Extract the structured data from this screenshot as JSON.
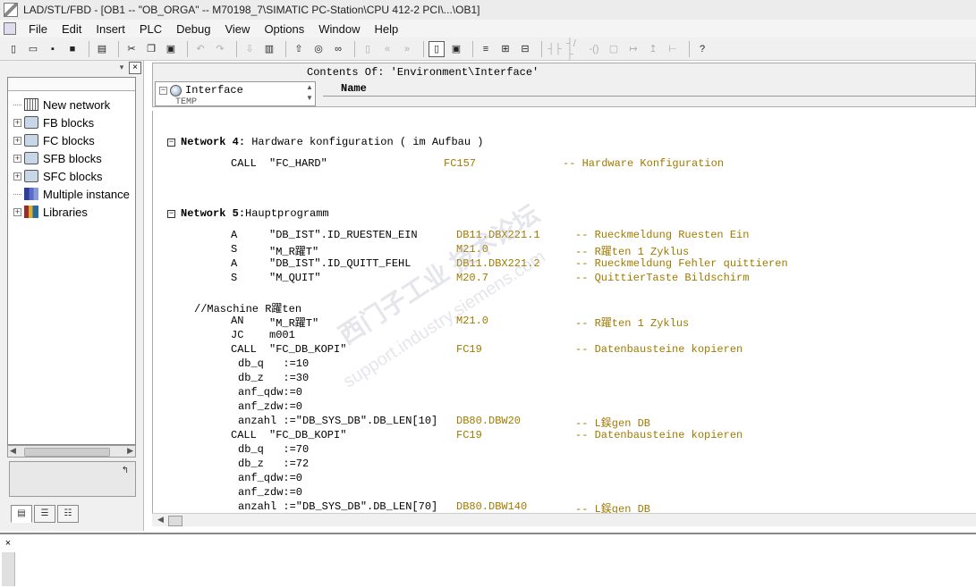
{
  "window": {
    "title": "LAD/STL/FBD  - [OB1 -- \"OB_ORGA\" -- M70198_7\\SIMATIC PC-Station\\CPU 412-2 PCI\\...\\OB1]"
  },
  "menu": {
    "items": [
      "File",
      "Edit",
      "Insert",
      "PLC",
      "Debug",
      "View",
      "Options",
      "Window",
      "Help"
    ]
  },
  "toolbar": {
    "icons": [
      "new-icon",
      "open-icon",
      "accessible-nodes-icon",
      "save-icon",
      "print-icon",
      "cut-icon",
      "copy-icon",
      "paste-icon",
      "undo-icon",
      "redo-icon",
      "load-icon",
      "module-info-icon",
      "load-icon-2",
      "monitor-icon",
      "insert-network-icon",
      "prev-network-icon",
      "next-network-icon",
      "overview-icon",
      "detail-icon",
      "ladder-icon",
      "branch-icon",
      "function-icon",
      "contact-no-icon",
      "contact-nc-icon",
      "coil-icon",
      "box-icon",
      "open-branch-icon",
      "close-branch-icon",
      "help-icon"
    ]
  },
  "sidebar": {
    "tree": [
      {
        "label": "New network",
        "icon": "network-icon",
        "expandable": false
      },
      {
        "label": "FB blocks",
        "icon": "fb-block-icon",
        "expandable": true
      },
      {
        "label": "FC blocks",
        "icon": "fc-block-icon",
        "expandable": true
      },
      {
        "label": "SFB blocks",
        "icon": "sfb-block-icon",
        "expandable": true
      },
      {
        "label": "SFC blocks",
        "icon": "sfc-block-icon",
        "expandable": true
      },
      {
        "label": "Multiple instance",
        "icon": "multiple-instance-icon",
        "expandable": false
      },
      {
        "label": "Libraries",
        "icon": "libraries-icon",
        "expandable": true
      }
    ],
    "expand_symbol": "+"
  },
  "interface": {
    "contents_of": "Contents Of: 'Environment\\Interface'",
    "root_label": "Interface",
    "sub_label": "TEMP",
    "name_header": "Name"
  },
  "networks": [
    {
      "number": "Network 4",
      "colon": ":",
      "title": " Hardware konfiguration ( im Aufbau )"
    },
    {
      "number": "Network 5",
      "colon": ":",
      "title": "Hauptprogramm"
    }
  ],
  "code": {
    "n4": [
      {
        "op": "CALL",
        "operand": "\"FC_HARD\"",
        "addr": "FC157",
        "comment": "-- Hardware Konfiguration"
      }
    ],
    "n5a": [
      {
        "op": "A",
        "operand": "\"DB_IST\".ID_RUESTEN_EIN",
        "addr": "DB11.DBX221.1",
        "comment": "-- Rueckmeldung Ruesten Ein"
      },
      {
        "op": "S",
        "operand": "\"M_R躍T\"",
        "addr": "M21.0",
        "comment": "-- R躍ten 1 Zyklus"
      },
      {
        "op": "A",
        "operand": "\"DB_IST\".ID_QUITT_FEHL",
        "addr": "DB11.DBX221.2",
        "comment": "-- Rueckmeldung Fehler quittieren"
      },
      {
        "op": "S",
        "operand": "\"M_QUIT\"",
        "addr": "M20.7",
        "comment": "-- QuittierTaste Bildschirm"
      }
    ],
    "label_comment": "//Maschine R躍ten",
    "n5b": [
      {
        "op": "AN",
        "operand": "\"M_R躍T\"",
        "addr": "M21.0",
        "comment": "-- R躍ten 1 Zyklus"
      },
      {
        "op": "JC",
        "operand": "m001",
        "addr": "",
        "comment": ""
      },
      {
        "op": "CALL",
        "operand": "\"FC_DB_KOPI\"",
        "addr": "FC19",
        "comment": "-- Datenbausteine kopieren"
      }
    ],
    "params1": [
      "db_q   :=10",
      "db_z   :=30",
      "anf_qdw:=0",
      "anf_zdw:=0"
    ],
    "anzahl1": {
      "text": "anzahl :=\"DB_SYS_DB\".DB_LEN[10]",
      "addr": "DB80.DBW20",
      "comment": "-- L鋘gen DB"
    },
    "call2": {
      "op": "CALL",
      "operand": "\"FC_DB_KOPI\"",
      "addr": "FC19",
      "comment": "-- Datenbausteine kopieren"
    },
    "params2": [
      "db_q   :=70",
      "db_z   :=72",
      "anf_qdw:=0",
      "anf_zdw:=0"
    ],
    "anzahl2": {
      "text": "anzahl :=\"DB_SYS_DB\".DB_LEN[70]",
      "addr": "DB80.DBW140",
      "comment": "-- L鋘gen DB"
    }
  },
  "watermark": {
    "line1": "西门子工业 技术论坛",
    "line2": "support.industry.siemens.com"
  },
  "colors": {
    "comment_color": "#a07a00",
    "addr_color": "#a07a00"
  }
}
